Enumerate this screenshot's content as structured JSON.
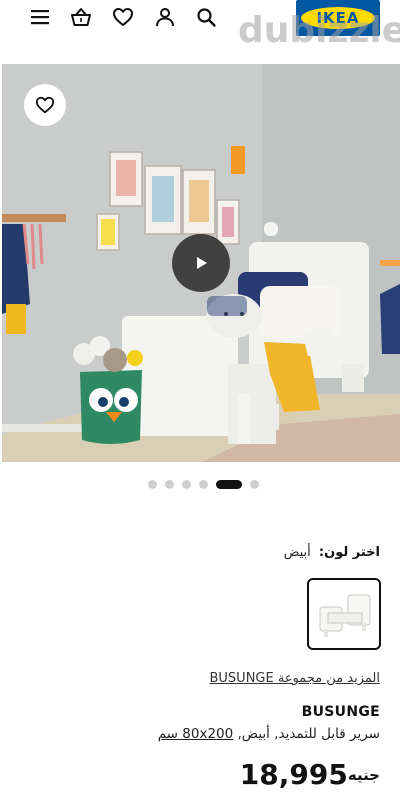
{
  "header": {
    "logo_text": "IKEA",
    "watermark": "dubizzle",
    "icons": [
      "menu-icon",
      "basket-icon",
      "heart-icon",
      "user-icon",
      "search-icon"
    ]
  },
  "gallery": {
    "dot_count": 6,
    "active_dot": 4
  },
  "product": {
    "color_label": "اختر لون:",
    "color_value": "أبيض",
    "more_from_series": "المزيد من مجموعة BUSUNGE",
    "name": "BUSUNGE",
    "description_main": "سرير قابل للتمديد, أبيض, ",
    "description_dims": "80x200 سم",
    "price": "18,995",
    "currency": "جنيه"
  },
  "colors": {
    "ikea_blue": "#0058a3",
    "ikea_yellow": "#ffdb00",
    "text": "#111111"
  }
}
